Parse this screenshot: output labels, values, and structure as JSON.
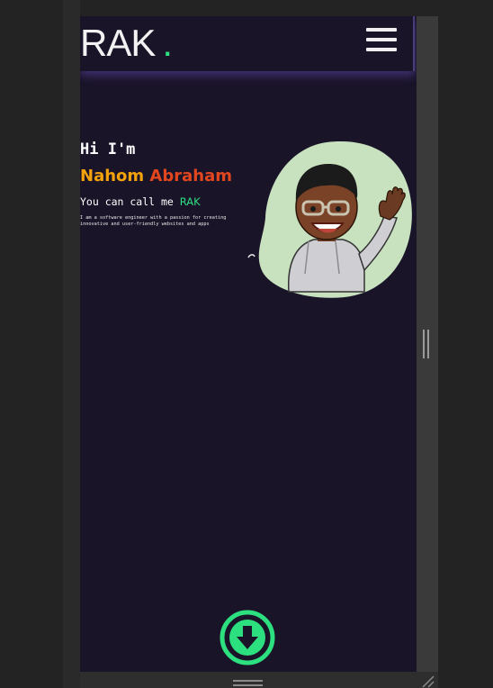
{
  "navbar": {
    "logo_text": "RAK",
    "logo_dot": ".",
    "menu_icon": "hamburger-menu-icon"
  },
  "hero": {
    "greeting": "Hi I'm",
    "name_part_a": "Nahom ",
    "name_part_b": "Abraham",
    "nickname_prefix": "You can call me ",
    "nickname": "RAK",
    "bio": "I am a software engineer with a passion for creating innovative and user-friendly websites and apps",
    "avatar_icon": "bitmoji-avatar-waving"
  },
  "download": {
    "icon": "download-arrow-icon"
  },
  "colors": {
    "background": "#1a1429",
    "accent_green": "#2de07f",
    "name_orange": "#f3a20c",
    "name_red": "#e2461e",
    "avatar_bg": "#c8e2c0"
  }
}
